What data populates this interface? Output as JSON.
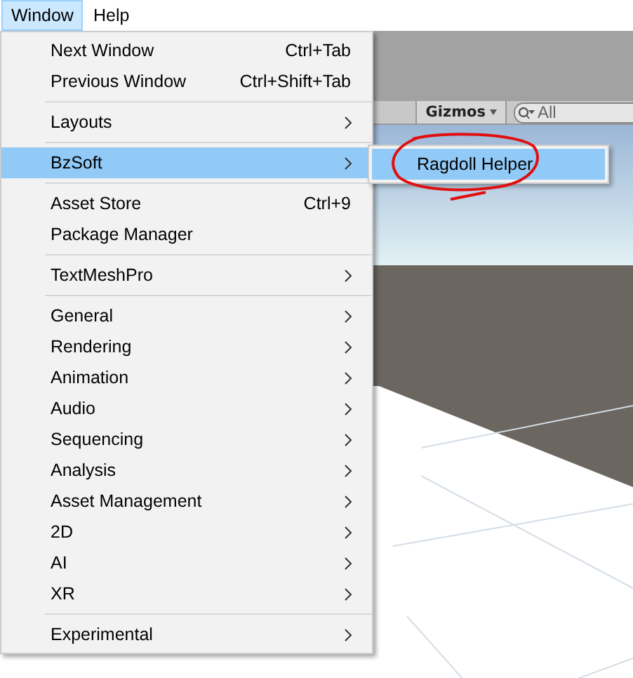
{
  "menubar": [
    {
      "label": "Window",
      "selected": true
    },
    {
      "label": "Help",
      "selected": false
    }
  ],
  "scene_toolbar": {
    "gizmos": "Gizmos",
    "search": {
      "placeholder": "All"
    }
  },
  "window_menu": {
    "groups": [
      {
        "items": [
          {
            "label": "Next Window",
            "shortcut": "Ctrl+Tab",
            "submenu": false,
            "selected": false
          },
          {
            "label": "Previous Window",
            "shortcut": "Ctrl+Shift+Tab",
            "submenu": false,
            "selected": false
          }
        ]
      },
      {
        "items": [
          {
            "label": "Layouts",
            "submenu": true,
            "selected": false
          }
        ]
      },
      {
        "items": [
          {
            "label": "BzSoft",
            "submenu": true,
            "selected": true
          }
        ]
      },
      {
        "items": [
          {
            "label": "Asset Store",
            "shortcut": "Ctrl+9",
            "submenu": false,
            "selected": false
          },
          {
            "label": "Package Manager",
            "submenu": false,
            "selected": false
          }
        ]
      },
      {
        "items": [
          {
            "label": "TextMeshPro",
            "submenu": true,
            "selected": false
          }
        ]
      },
      {
        "items": [
          {
            "label": "General",
            "submenu": true,
            "selected": false
          },
          {
            "label": "Rendering",
            "submenu": true,
            "selected": false
          },
          {
            "label": "Animation",
            "submenu": true,
            "selected": false
          },
          {
            "label": "Audio",
            "submenu": true,
            "selected": false
          },
          {
            "label": "Sequencing",
            "submenu": true,
            "selected": false
          },
          {
            "label": "Analysis",
            "submenu": true,
            "selected": false
          },
          {
            "label": "Asset Management",
            "submenu": true,
            "selected": false
          },
          {
            "label": "2D",
            "submenu": true,
            "selected": false
          },
          {
            "label": "AI",
            "submenu": true,
            "selected": false
          },
          {
            "label": "XR",
            "submenu": true,
            "selected": false
          }
        ]
      },
      {
        "items": [
          {
            "label": "Experimental",
            "submenu": true,
            "selected": false
          }
        ]
      }
    ]
  },
  "submenu": {
    "items": [
      {
        "label": "Ragdoll Helper",
        "selected": true,
        "circled": true
      }
    ]
  }
}
